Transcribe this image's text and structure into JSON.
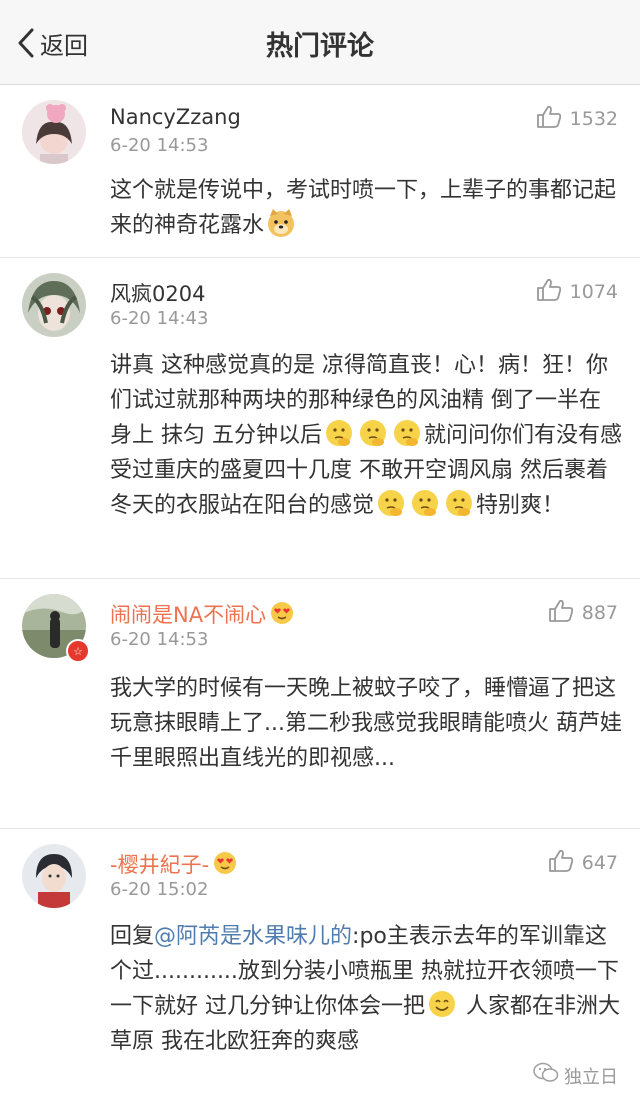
{
  "nav": {
    "back_label": "返回",
    "title": "热门评论"
  },
  "comments": [
    {
      "username": "NancyZzang",
      "time": "6-20 14:53",
      "likes": "1532",
      "text": "这个就是传说中，考试时喷一下，上辈子的事都记起来的神奇花露水"
    },
    {
      "username": "风疯0204",
      "time": "6-20 14:43",
      "likes": "1074",
      "text_a": "讲真 这种感觉真的是 凉得简直丧！心！病！狂！你们试过就那种两块的那种绿色的风油精 倒了一半在身上 抹匀 五分钟以后",
      "text_b": "就问问你们有没有感受过重庆的盛夏四十几度 不敢开空调风扇 然后裹着冬天的衣服站在阳台的感觉",
      "text_c": "特别爽！"
    },
    {
      "username": "闹闹是NA不闹心",
      "time": "6-20 14:53",
      "likes": "887",
      "badge": "☆",
      "text": "我大学的时候有一天晚上被蚊子咬了，睡懵逼了把这玩意抹眼睛上了...第二秒我感觉我眼睛能喷火 葫芦娃千里眼照出直线光的即视感..."
    },
    {
      "username": "-樱井紀子-",
      "time": "6-20 15:02",
      "likes": "647",
      "reply_prefix": "回复",
      "mention": "@阿芮是水果味儿的",
      "text_a": ":po主表示去年的军训靠这个过............放到分装小喷瓶里 热就拉开衣领喷一下 一下就好 过几分钟让你体会一把",
      "text_b": " 人家都在非洲大草原 我在北欧狂奔的爽感"
    }
  ],
  "watermark": "独立日",
  "icons": {
    "back": "chevron-left-icon",
    "like": "thumbs-up-icon",
    "doge": "doge-emoji-icon",
    "thinking": "thinking-emoji-icon",
    "love": "heart-eyes-emoji-icon",
    "smile": "smile-emoji-icon",
    "wechat": "wechat-icon"
  },
  "colors": {
    "nav_bg": "#f7f7f7",
    "vip_name": "#eb7350",
    "mention": "#507daf",
    "muted": "#999999",
    "text": "#333333"
  }
}
